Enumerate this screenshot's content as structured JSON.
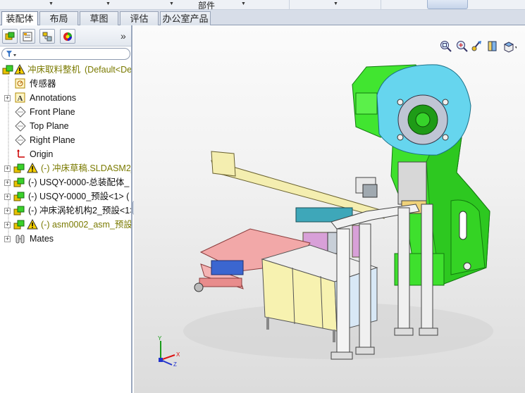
{
  "top_strip": {
    "group_label": "部件"
  },
  "tabs": [
    {
      "label": "装配体",
      "active": true
    },
    {
      "label": "布局",
      "active": false
    },
    {
      "label": "草图",
      "active": false
    },
    {
      "label": "评估",
      "active": false
    },
    {
      "label": "办公室产品",
      "active": false
    }
  ],
  "feature_tree": {
    "root": {
      "label": "冲床取料整机",
      "config": "(Default<De"
    },
    "items": [
      {
        "label": "传感器"
      },
      {
        "label": "Annotations"
      },
      {
        "label": "Front Plane"
      },
      {
        "label": "Top Plane"
      },
      {
        "label": "Right Plane"
      },
      {
        "label": "Origin"
      },
      {
        "label": "(-) 冲床草稿.SLDASM2_"
      },
      {
        "label": "(-) USQY-0000-总装配体_"
      },
      {
        "label": "(-) USQY-0000_预設<1> ("
      },
      {
        "label": "(-) 冲床涡轮机构2_预設<1>"
      },
      {
        "label": "(-) asm0002_asm_预設"
      },
      {
        "label": "Mates"
      }
    ]
  },
  "view_toolbar": {
    "icons": [
      "zoom-to-fit-icon",
      "zoom-to-area-icon",
      "previous-view-icon",
      "section-view-icon",
      "view-orientation-icon"
    ]
  },
  "triad": {
    "x": "X",
    "y": "Y",
    "z": "Z"
  },
  "colors": {
    "warning": "#e8c300",
    "assembly_green": "#39e02a",
    "machine_cyan": "#63d6ee",
    "table_pink": "#f0a7a7",
    "highlight": "#7a7a00"
  }
}
